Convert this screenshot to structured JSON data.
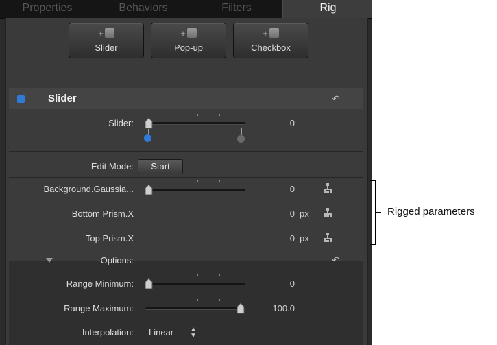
{
  "tabs": [
    {
      "label": "Properties",
      "active": false
    },
    {
      "label": "Behaviors",
      "active": false
    },
    {
      "label": "Filters",
      "active": false
    },
    {
      "label": "Rig",
      "active": true
    }
  ],
  "add_buttons": [
    {
      "plus": "+",
      "label": "Slider",
      "icon": "slider-widget-icon"
    },
    {
      "plus": "+",
      "label": "Pop-up",
      "icon": "popup-widget-icon"
    },
    {
      "plus": "+",
      "label": "Checkbox",
      "icon": "checkbox-widget-icon"
    }
  ],
  "widget": {
    "title": "Slider",
    "color": "#2f7bd8",
    "reset_icon": "reset-arrow-icon"
  },
  "slider_row": {
    "label": "Slider:",
    "value": "0",
    "snapshot_colors": [
      "#2f7bd8",
      "#6a6a6a"
    ]
  },
  "edit_mode": {
    "label": "Edit Mode:",
    "button": "Start"
  },
  "rigged": [
    {
      "label": "Background.Gaussia...",
      "value": "0",
      "unit": "",
      "has_slider": true
    },
    {
      "label": "Bottom Prism.X",
      "value": "0",
      "unit": "px",
      "has_slider": false
    },
    {
      "label": "Top Prism.X",
      "value": "0",
      "unit": "px",
      "has_slider": false
    }
  ],
  "options": {
    "label": "Options:"
  },
  "range_min": {
    "label": "Range Minimum:",
    "value": "0",
    "fraction": 0
  },
  "range_max": {
    "label": "Range Maximum:",
    "value": "100.0",
    "fraction": 1
  },
  "interpolation": {
    "label": "Interpolation:",
    "value": "Linear",
    "arrows": "⌃⌄"
  },
  "callout": {
    "text": "Rigged parameters"
  },
  "colors": {
    "panel": "#2b2b2b",
    "accent": "#2f7bd8"
  }
}
